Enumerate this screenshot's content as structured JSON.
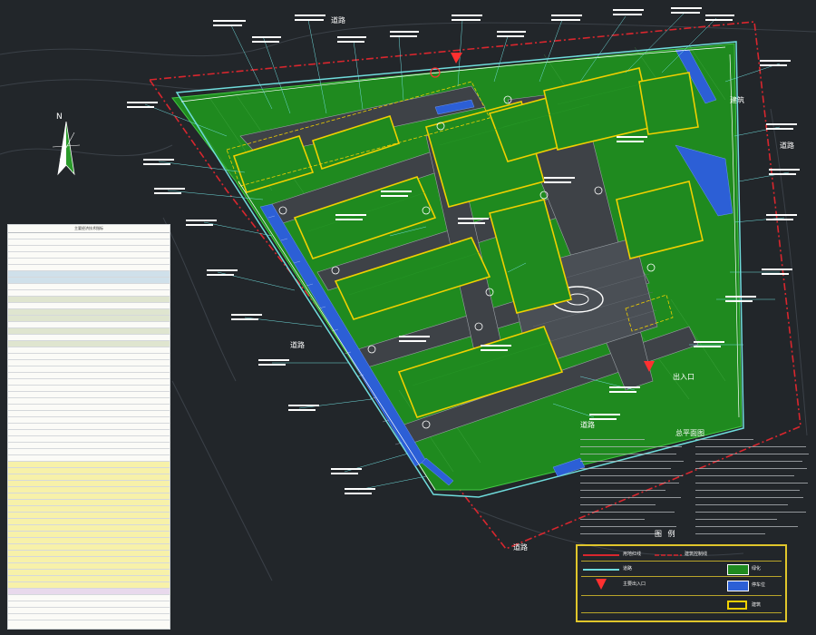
{
  "colors": {
    "background": "#22262a",
    "site_boundary": "#d9262e",
    "green_space": "#1f8a1f",
    "road_fill": "#3e4247",
    "building_outline": "#f0d000",
    "parking": "#2c5fd6",
    "annotation": "#ffffff",
    "leader": "#6fdcdc",
    "entrance_marker": "#ff3030",
    "legend_border": "#e0c62b"
  },
  "icons": {
    "north_arrow": "north-arrow-icon",
    "entrance": "red-arrow-icon",
    "fountain": "ellipse-fountain-icon"
  },
  "north_label": "N",
  "legend_title": "图 例",
  "notes_title": "总平面图",
  "legend_items": [
    {
      "label": "用地红线",
      "swatch": "red-line"
    },
    {
      "label": "建筑控制线",
      "swatch": "red-dash"
    },
    {
      "label": "道路",
      "swatch": "cyan-line"
    },
    {
      "label": "绿化",
      "swatch": "green"
    },
    {
      "label": "主要出入口",
      "swatch": "red-arrow"
    },
    {
      "label": "停车位",
      "swatch": "blue"
    },
    {
      "label": "建筑",
      "swatch": "yellow-box"
    }
  ],
  "map_labels": [
    {
      "text": "道路"
    },
    {
      "text": "建筑"
    },
    {
      "text": "道路"
    },
    {
      "text": "道路"
    },
    {
      "text": "道路"
    },
    {
      "text": "道路"
    },
    {
      "text": "出入口"
    }
  ],
  "spec_table_title": "主要经济技术指标"
}
